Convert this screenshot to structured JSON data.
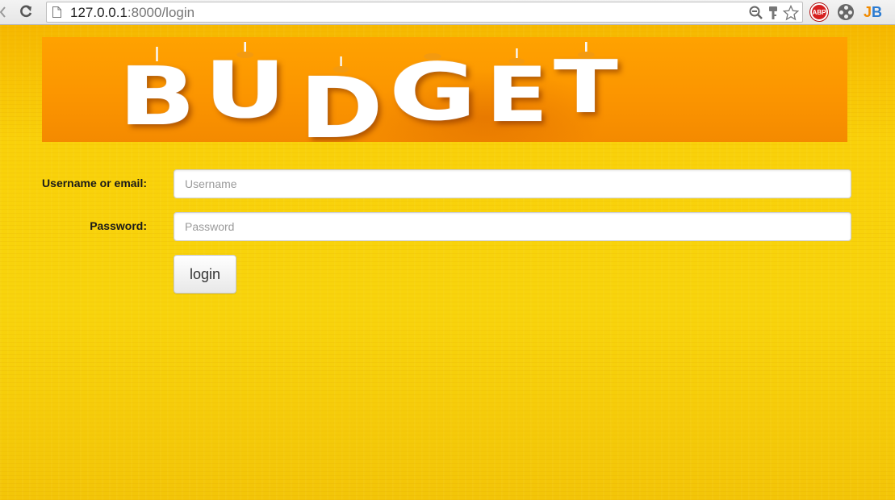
{
  "browser": {
    "url_host": "127.0.0.1",
    "url_rest": ":8000/login",
    "extensions": {
      "abp_label": "ABP",
      "jb_label_j": "J",
      "jb_label_b": "B"
    },
    "icons": [
      "back-arrow-icon",
      "reload-icon",
      "page-icon",
      "zoom-icon",
      "key-icon",
      "star-icon",
      "adblock-icon",
      "film-reel-icon",
      "jetbrains-icon"
    ]
  },
  "banner": {
    "letters": [
      "B",
      "U",
      "D",
      "G",
      "E",
      "T"
    ]
  },
  "form": {
    "username_label": "Username or email:",
    "username_placeholder": "Username",
    "password_label": "Password:",
    "password_placeholder": "Password",
    "login_label": "login"
  },
  "colors": {
    "background": "#f7cf0d",
    "banner": "#fb9400",
    "abp": "#d62020"
  }
}
